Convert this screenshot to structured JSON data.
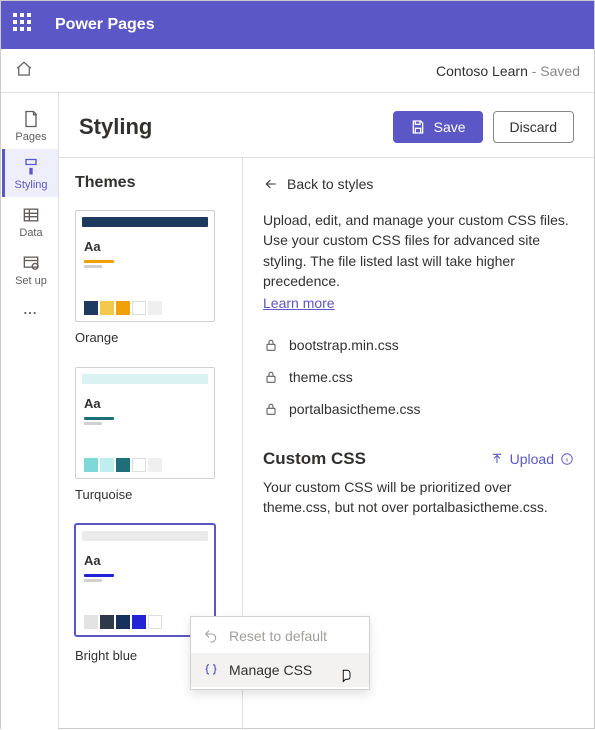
{
  "header": {
    "appName": "Power Pages"
  },
  "siteBar": {
    "siteName": "Contoso Learn",
    "statusSuffix": " - Saved"
  },
  "rail": {
    "items": [
      {
        "label": "Pages"
      },
      {
        "label": "Styling"
      },
      {
        "label": "Data"
      },
      {
        "label": "Set up"
      }
    ]
  },
  "contentHeader": {
    "title": "Styling",
    "saveLabel": "Save",
    "discardLabel": "Discard"
  },
  "themesPanel": {
    "title": "Themes",
    "themes": [
      {
        "name": "Orange",
        "topColor": "#1f3a5f",
        "accent": "#f2a007",
        "swatches": [
          "#1f3a5f",
          "#f2c94c",
          "#f2a007",
          "#ffffff",
          "#efefef"
        ]
      },
      {
        "name": "Turquoise",
        "topColor": "#d9f3f3",
        "accent": "#1f6f7a",
        "swatches": [
          "#7fd8d8",
          "#bfeeee",
          "#1f6f7a",
          "#ffffff",
          "#efefef"
        ]
      },
      {
        "name": "Bright blue",
        "topColor": "#eaeaea",
        "accent": "#2323d6",
        "swatches": [
          "#e3e3e3",
          "#2e3a4a",
          "#16325c",
          "#2323d6",
          "#ffffff"
        ]
      }
    ]
  },
  "details": {
    "backLabel": "Back to styles",
    "description": "Upload, edit, and manage your custom CSS files. Use your custom CSS files for advanced site styling. The file listed last will take higher precedence.",
    "learnMore": "Learn more",
    "files": [
      "bootstrap.min.css",
      "theme.css",
      "portalbasictheme.css"
    ],
    "customTitle": "Custom CSS",
    "uploadLabel": "Upload",
    "customDesc": "Your custom CSS will be prioritized over theme.css, but not over portalbasictheme.css."
  },
  "contextMenu": {
    "reset": "Reset to default",
    "manage": "Manage CSS"
  }
}
